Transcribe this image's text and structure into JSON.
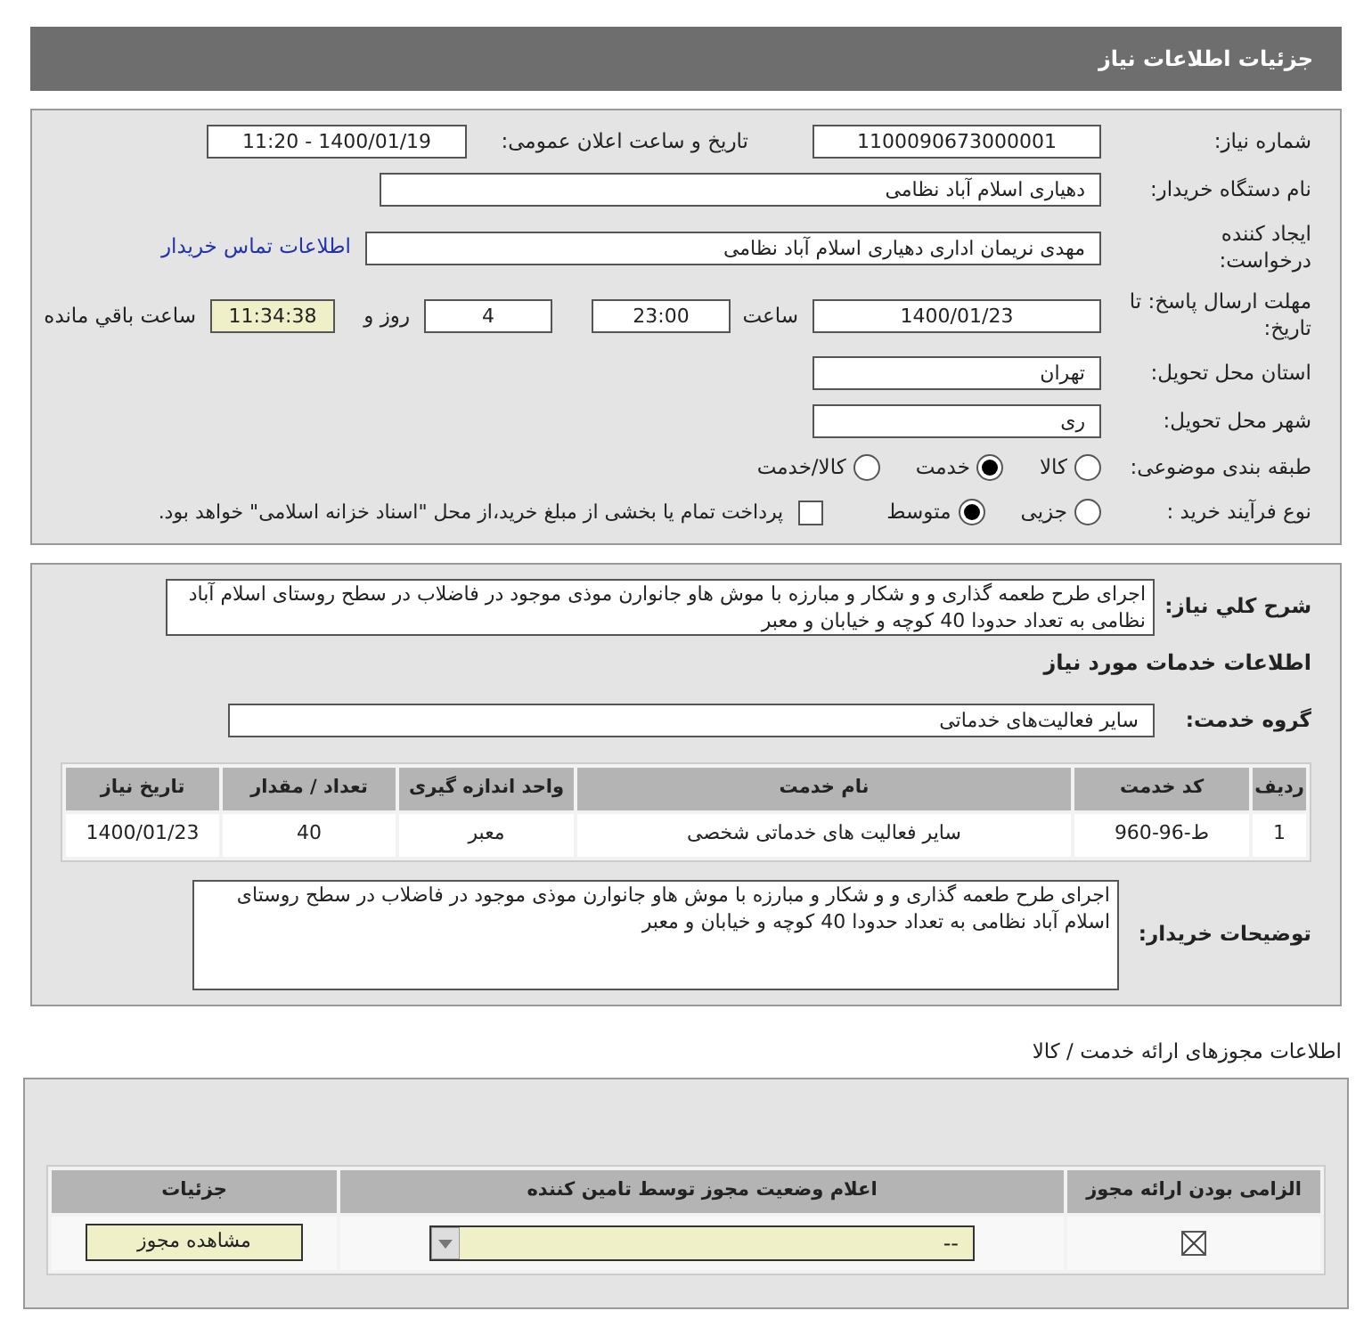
{
  "header": {
    "title": "جزئیات اطلاعات نیاز"
  },
  "fields": {
    "need_number": {
      "label": "شماره نیاز:",
      "value": "1100090673000001"
    },
    "announce": {
      "label": "تاریخ و ساعت اعلان عمومی:",
      "value": "1400/01/19 - 11:20"
    },
    "buyer": {
      "label": "نام دستگاه خریدار:",
      "value": "دهیاری اسلام آباد نظامی"
    },
    "creator": {
      "label": "ایجاد کننده درخواست:",
      "value": "مهدی  نریمان اداری دهیاری اسلام آباد نظامی",
      "link": "اطلاعات تماس خریدار"
    },
    "deadline": {
      "label": "مهلت ارسال پاسخ: تا تاریخ:",
      "date": "1400/01/23",
      "time_label": "ساعت",
      "time": "23:00",
      "days": "4",
      "days_label": "روز و",
      "remaining": "11:34:38",
      "remaining_label": "ساعت باقي مانده"
    },
    "province": {
      "label": "استان محل تحویل:",
      "value": "تهران"
    },
    "city": {
      "label": "شهر محل تحویل:",
      "value": "ری"
    },
    "category": {
      "label": "طبقه بندی موضوعی:",
      "options": [
        {
          "label": "کالا",
          "selected": false
        },
        {
          "label": "خدمت",
          "selected": true
        },
        {
          "label": "کالا/خدمت",
          "selected": false
        }
      ]
    },
    "process": {
      "label": "نوع فرآیند خرید :",
      "options": [
        {
          "label": "جزیی",
          "selected": false
        },
        {
          "label": "متوسط",
          "selected": true
        }
      ],
      "treasury": {
        "label": "پرداخت تمام یا بخشی از مبلغ خرید،از محل \"اسناد خزانه اسلامی\" خواهد بود.",
        "checked": false
      }
    }
  },
  "description": {
    "label": "شرح کلي نياز:",
    "value": "اجرای طرح طعمه گذاری و و شکار و مبارزه با موش هاو جانوارن موذی موجود در فاضلاب در سطح روستای اسلام آباد نظامی به تعداد حدودا 40 کوچه و خیابان و معبر"
  },
  "services_heading": "اطلاعات خدمات مورد نیاز",
  "service_group": {
    "label": "گروه خدمت:",
    "value": "سایر فعالیت‌های خدماتی"
  },
  "services_table": {
    "columns": [
      "ردیف",
      "کد خدمت",
      "نام خدمت",
      "واحد اندازه گیری",
      "تعداد / مقدار",
      "تاریخ نیاز"
    ],
    "rows": [
      [
        "1",
        "ط-96-960",
        "سایر فعالیت های خدماتی شخصی",
        "معبر",
        "40",
        "1400/01/23"
      ]
    ]
  },
  "buyer_notes": {
    "label": "توضیحات خریدار:",
    "value": "اجرای طرح طعمه گذاری و و شکار و مبارزه با موش هاو جانوارن موذی موجود در فاضلاب در سطح روستای اسلام آباد نظامی به تعداد حدودا 40 کوچه و خیابان و معبر"
  },
  "permits": {
    "heading": "اطلاعات مجوزهای ارائه خدمت / کالا",
    "columns": [
      "الزامی بودن ارائه مجوز",
      "اعلام وضعیت مجوز توسط تامین کننده",
      "جزئیات"
    ],
    "rows": [
      {
        "required": true,
        "status": "--",
        "action": "مشاهده مجوز"
      }
    ]
  }
}
